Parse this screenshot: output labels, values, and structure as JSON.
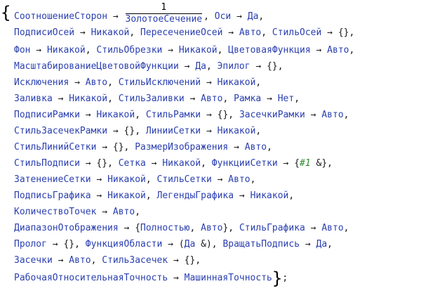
{
  "lines": [
    [
      "СоотношениеСторон",
      " → ",
      "__FRAC__",
      ", ",
      "Оси",
      " → ",
      "Да",
      ","
    ],
    [
      "ПодписиОсей",
      " → ",
      "Никакой",
      ", ",
      "ПересечениеОсей",
      " → ",
      "Авто",
      ", ",
      "СтильОсей",
      " → ",
      "{}",
      ","
    ],
    [
      "Фон",
      " → ",
      "Никакой",
      ", ",
      "СтильОбрезки",
      " → ",
      "Никакой",
      ", ",
      "ЦветоваяФункция",
      " → ",
      "Авто",
      ","
    ],
    [
      "МасштабированиеЦветовойФункции",
      " → ",
      "Да",
      ", ",
      "Эпилог",
      " → ",
      "{}",
      ","
    ],
    [
      "Исключения",
      " → ",
      "Авто",
      ", ",
      "СтильИсключений",
      " → ",
      "Никакой",
      ","
    ],
    [
      "Заливка",
      " → ",
      "Никакой",
      ", ",
      "СтильЗаливки",
      " → ",
      "Авто",
      ", ",
      "Рамка",
      " → ",
      "Нет",
      ","
    ],
    [
      "ПодписиРамки",
      " → ",
      "Никакой",
      ", ",
      "СтильРамки",
      " → ",
      "{}",
      ", ",
      "ЗасечкиРамки",
      " → ",
      "Авто",
      ","
    ],
    [
      "СтильЗасечекРамки",
      " → ",
      "{}",
      ", ",
      "ЛинииСетки",
      " → ",
      "Никакой",
      ","
    ],
    [
      "СтильЛинийСетки",
      " → ",
      "{}",
      ", ",
      "РазмерИзображения",
      " → ",
      "Авто",
      ","
    ],
    [
      "СтильПодписи",
      " → ",
      "{}",
      ", ",
      "Сетка",
      " → ",
      "Никакой",
      ", ",
      "ФункцииСетки",
      " → ",
      "{",
      "__SLOT__",
      " &}",
      ","
    ],
    [
      "ЗатенениеСетки",
      " → ",
      "Никакой",
      ", ",
      "СтильСетки",
      " → ",
      "Авто",
      ","
    ],
    [
      "ПодписьГрафика",
      " → ",
      "Никакой",
      ", ",
      "ЛегендыГрафика",
      " → ",
      "Никакой",
      ","
    ],
    [
      "КоличествоТочек",
      " → ",
      "Авто",
      ","
    ],
    [
      "ДиапазонОтображения",
      " → ",
      "{",
      "Полностью",
      ", ",
      "Авто",
      "}",
      ", ",
      "СтильГрафика",
      " → ",
      "Авто",
      ","
    ],
    [
      "Пролог",
      " → ",
      "{}",
      ", ",
      "ФункцияОбласти",
      " → ",
      "(",
      "Да",
      " &)",
      ", ",
      "ВращатьПодпись",
      " → ",
      "Да",
      ","
    ],
    [
      "Засечки",
      " → ",
      "Авто",
      ", ",
      "СтильЗасечек",
      " → ",
      "{}",
      ","
    ],
    [
      "РабочаяОтносительнаяТочность",
      " → ",
      "МашиннаяТочность",
      "__CLOSE__",
      ";"
    ]
  ],
  "fraction": {
    "numerator": "1",
    "denominator": "ЗолотоеСечение"
  },
  "slot_text": "#1",
  "brace_open": "{",
  "brace_close": "}",
  "colors": {
    "token": "#2a3fb0",
    "slot": "#2e8b2e",
    "text": "#000000"
  }
}
